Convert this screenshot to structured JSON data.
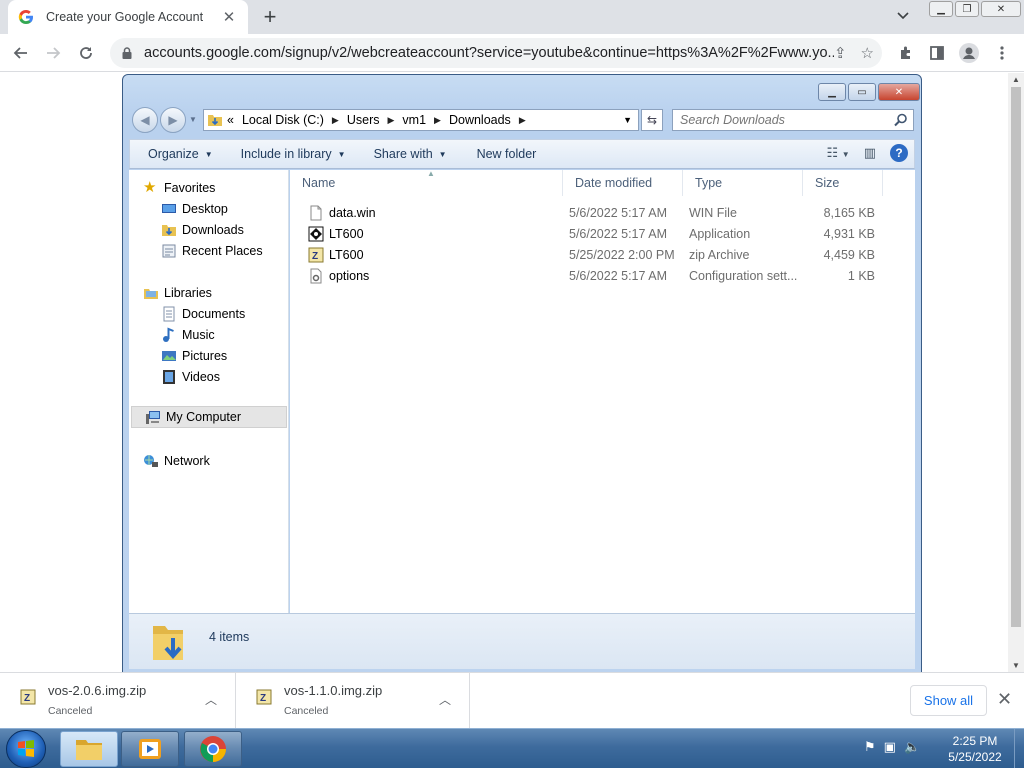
{
  "browser": {
    "tab_title": "Create your Google Account",
    "url": "accounts.google.com/signup/v2/webcreateaccount?service=youtube&continue=https%3A%2F%2Fwww.yo..."
  },
  "explorer": {
    "breadcrumb": [
      "Local Disk (C:)",
      "Users",
      "vm1",
      "Downloads"
    ],
    "breadcrumb_prefix": "«",
    "search_placeholder": "Search Downloads",
    "commands": {
      "organize": "Organize",
      "include_in_library": "Include in library",
      "share_with": "Share with",
      "new_folder": "New folder"
    },
    "nav": {
      "favorites": "Favorites",
      "desktop": "Desktop",
      "downloads": "Downloads",
      "recent_places": "Recent Places",
      "libraries": "Libraries",
      "documents": "Documents",
      "music": "Music",
      "pictures": "Pictures",
      "videos": "Videos",
      "my_computer": "My Computer",
      "network": "Network"
    },
    "columns": {
      "name": "Name",
      "date_modified": "Date modified",
      "type": "Type",
      "size": "Size"
    },
    "files": [
      {
        "name": "data.win",
        "date": "5/6/2022 5:17 AM",
        "type": "WIN File",
        "size": "8,165 KB",
        "icon": "blank-file-icon"
      },
      {
        "name": "LT600",
        "date": "5/6/2022 5:17 AM",
        "type": "Application",
        "size": "4,931 KB",
        "icon": "application-icon"
      },
      {
        "name": "LT600",
        "date": "5/25/2022 2:00 PM",
        "type": "zip Archive",
        "size": "4,459 KB",
        "icon": "zip-archive-icon"
      },
      {
        "name": "options",
        "date": "5/6/2022 5:17 AM",
        "type": "Configuration sett...",
        "size": "1 KB",
        "icon": "config-file-icon"
      }
    ],
    "item_count": "4 items"
  },
  "downloads": [
    {
      "file": "vos-2.0.6.img.zip",
      "status": "Canceled"
    },
    {
      "file": "vos-1.1.0.img.zip",
      "status": "Canceled"
    }
  ],
  "shelf": {
    "show_all": "Show all"
  },
  "taskbar": {
    "time": "2:25 PM",
    "date": "5/25/2022"
  }
}
